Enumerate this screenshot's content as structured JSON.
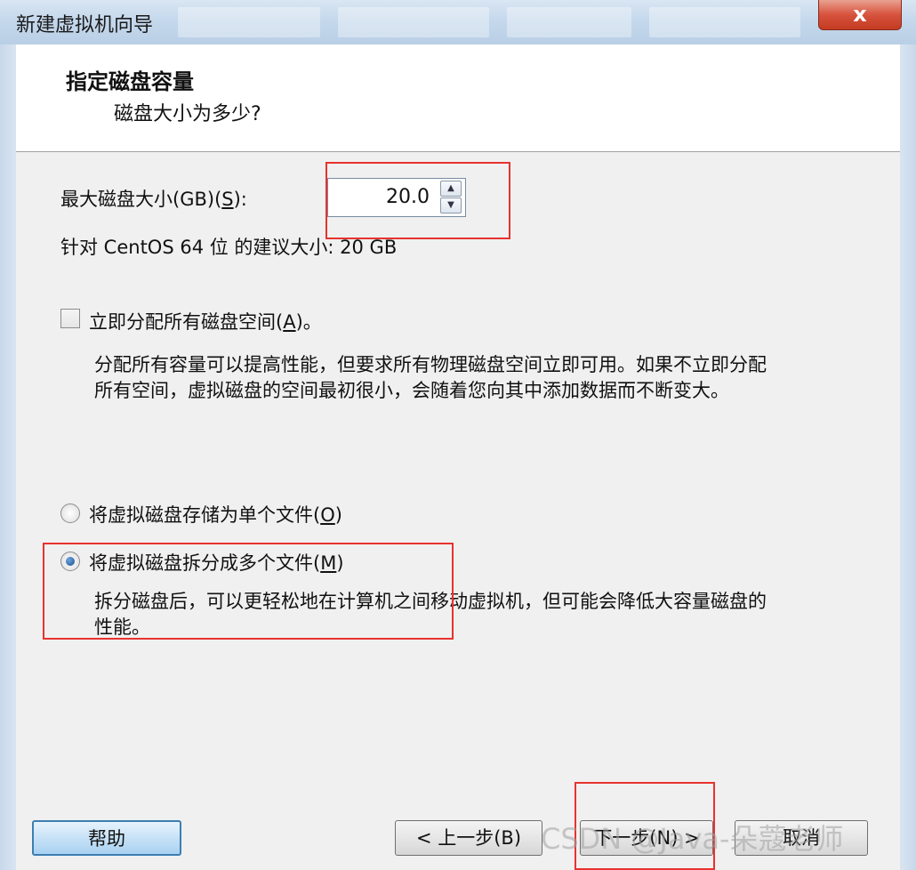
{
  "window": {
    "title": "新建虚拟机向导",
    "close_glyph": "x"
  },
  "header": {
    "title": "指定磁盘容量",
    "subtitle": "磁盘大小为多少?"
  },
  "disk_size": {
    "label_pre": "最大磁盘大小(GB)(",
    "label_key": "S",
    "label_post": "):",
    "value": "20.0",
    "up_glyph": "▲",
    "down_glyph": "▼",
    "recommend": "针对 CentOS 64 位 的建议大小: 20 GB"
  },
  "allocate": {
    "checked": false,
    "label_pre": "立即分配所有磁盘空间(",
    "label_key": "A",
    "label_post": ")。",
    "desc_line1": "分配所有容量可以提高性能，但要求所有物理磁盘空间立即可用。如果不立即分配",
    "desc_line2": "所有空间，虚拟磁盘的空间最初很小，会随着您向其中添加数据而不断变大。"
  },
  "storage": {
    "single": {
      "label_pre": "将虚拟磁盘存储为单个文件(",
      "label_key": "O",
      "label_post": ")",
      "selected": false
    },
    "split": {
      "label_pre": "将虚拟磁盘拆分成多个文件(",
      "label_key": "M",
      "label_post": ")",
      "selected": true,
      "desc_line1": "拆分磁盘后，可以更轻松地在计算机之间移动虚拟机，但可能会降低大容量磁盘的",
      "desc_line2": "性能。"
    }
  },
  "buttons": {
    "help": "帮助",
    "back": "< 上一步(B)",
    "next": "下一步(N) >",
    "cancel": "取消"
  },
  "watermark": "CSDN @Java-朵蔻老师",
  "colors": {
    "highlight_box": "#e8322f",
    "title_bar": "#c5d8ec",
    "close": "#d7533d"
  }
}
